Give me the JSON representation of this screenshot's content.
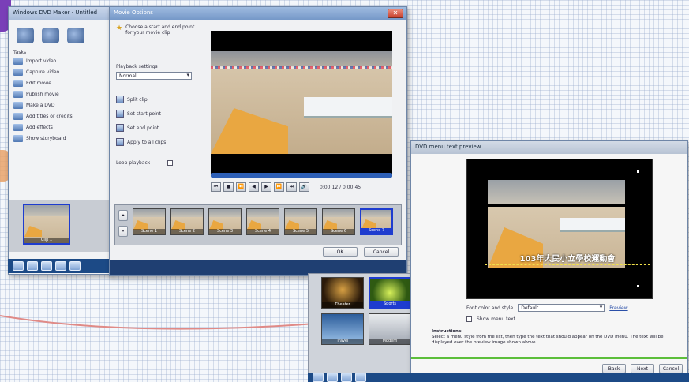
{
  "back_window": {
    "title": "Windows DVD Maker - Untitled",
    "section_label": "Tasks",
    "tasks": [
      "Import video",
      "Capture video",
      "Edit movie",
      "Publish movie",
      "Make a DVD",
      "Add titles or credits",
      "Add effects",
      "Show storyboard"
    ],
    "clip_label": "Clip 1"
  },
  "front_dialog": {
    "title": "Movie Options",
    "intro": "Choose a start and end point for your movie clip",
    "combo_label": "Playback settings",
    "combo_value": "Normal",
    "options": [
      "Split clip",
      "Set start point",
      "Set end point",
      "Apply to all clips"
    ],
    "checkbox_label": "Loop playback",
    "time_display": "0:00:12 / 0:00:45",
    "controls": [
      "⏮",
      "■",
      "⏪",
      "◀",
      "▶",
      "⏩",
      "⏭",
      "🔊"
    ],
    "filmstrip": [
      "Scene 1",
      "Scene 2",
      "Scene 3",
      "Scene 4",
      "Scene 5",
      "Scene 6",
      "Scene 7"
    ],
    "ok_label": "OK",
    "cancel_label": "Cancel"
  },
  "right_window": {
    "title": "DVD menu text preview",
    "caption": "103年大民小立學校運動會",
    "font_label": "Font color and style",
    "font_value": "Default",
    "checkbox_label": "Show menu text",
    "link_label": "Preview",
    "desc_heading": "Instructions:",
    "desc_text": "Select a menu style from the list, then type the text that should appear on the DVD menu. The text will be displayed over the preview image shown above.",
    "buttons": [
      "Back",
      "Next",
      "Cancel"
    ]
  },
  "style_panel": {
    "labels": [
      "Theater",
      "Sports",
      "Travel",
      "Modern"
    ]
  },
  "colors": {
    "title_bar": "#7598c8",
    "taskbar": "#1c4a86",
    "selection": "#1e3ccf",
    "caption_text": "#ffffff",
    "arc_line": "#e08a86"
  }
}
